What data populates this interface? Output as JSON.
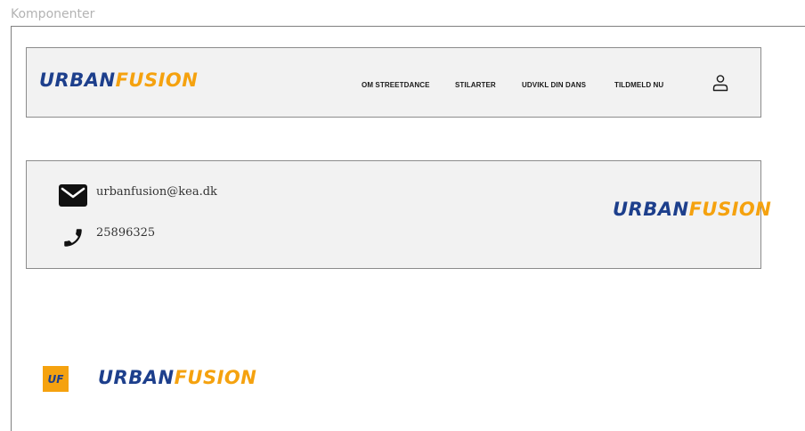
{
  "frame": {
    "label": "Komponenter"
  },
  "header": {
    "logo": {
      "part1": "URBAN",
      "part2": "FUSION"
    },
    "nav": [
      {
        "label": "OM STREETDANCE"
      },
      {
        "label": "STILARTER"
      },
      {
        "label": "UDVIKL DIN DANS"
      },
      {
        "label": "TILDMELD NU"
      }
    ],
    "user_icon": "user-icon"
  },
  "footer": {
    "email": "urbanfusion@kea.dk",
    "phone": "25896325",
    "mail_icon": "mail-icon",
    "phone_icon": "phone-icon",
    "logo": {
      "part1": "URBAN",
      "part2": "FUSION"
    }
  },
  "favicon": {
    "part1": "U",
    "part2": "F"
  },
  "standalone_logo": {
    "part1": "URBAN",
    "part2": "FUSION"
  },
  "colors": {
    "brand_blue": "#1d3f8c",
    "brand_orange": "#f5a20f",
    "panel_bg": "#f2f2f2"
  }
}
